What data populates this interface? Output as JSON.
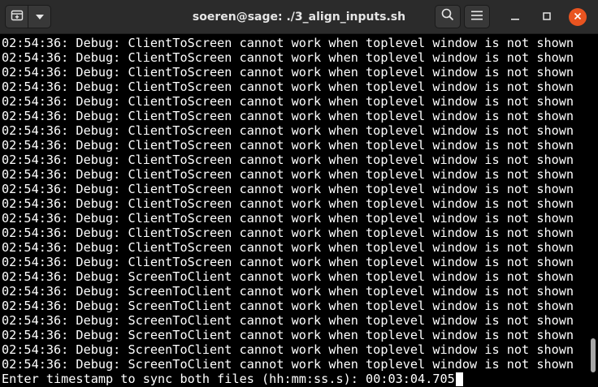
{
  "window": {
    "title": "soeren@sage: ./3_align_inputs.sh"
  },
  "toolbar": {
    "icons": {
      "new_tab": "new-tab-icon",
      "menu_dropdown": "chevron-down-icon",
      "search": "search-icon",
      "menu": "hamburger-icon",
      "minimize": "minimize-icon",
      "maximize": "maximize-icon",
      "close": "close-icon"
    }
  },
  "terminal": {
    "lines": [
      "02:54:36: Debug: ClientToScreen cannot work when toplevel window is not shown",
      "02:54:36: Debug: ClientToScreen cannot work when toplevel window is not shown",
      "02:54:36: Debug: ClientToScreen cannot work when toplevel window is not shown",
      "02:54:36: Debug: ClientToScreen cannot work when toplevel window is not shown",
      "02:54:36: Debug: ClientToScreen cannot work when toplevel window is not shown",
      "02:54:36: Debug: ClientToScreen cannot work when toplevel window is not shown",
      "02:54:36: Debug: ClientToScreen cannot work when toplevel window is not shown",
      "02:54:36: Debug: ClientToScreen cannot work when toplevel window is not shown",
      "02:54:36: Debug: ClientToScreen cannot work when toplevel window is not shown",
      "02:54:36: Debug: ClientToScreen cannot work when toplevel window is not shown",
      "02:54:36: Debug: ClientToScreen cannot work when toplevel window is not shown",
      "02:54:36: Debug: ClientToScreen cannot work when toplevel window is not shown",
      "02:54:36: Debug: ClientToScreen cannot work when toplevel window is not shown",
      "02:54:36: Debug: ClientToScreen cannot work when toplevel window is not shown",
      "02:54:36: Debug: ClientToScreen cannot work when toplevel window is not shown",
      "02:54:36: Debug: ClientToScreen cannot work when toplevel window is not shown",
      "02:54:36: Debug: ScreenToClient cannot work when toplevel window is not shown",
      "02:54:36: Debug: ScreenToClient cannot work when toplevel window is not shown",
      "02:54:36: Debug: ScreenToClient cannot work when toplevel window is not shown",
      "02:54:36: Debug: ScreenToClient cannot work when toplevel window is not shown",
      "02:54:36: Debug: ScreenToClient cannot work when toplevel window is not shown",
      "02:54:36: Debug: ScreenToClient cannot work when toplevel window is not shown",
      "02:54:36: Debug: ScreenToClient cannot work when toplevel window is not shown"
    ],
    "prompt": "Enter timestamp to sync both files (hh:mm:ss.s): ",
    "input_value": "00:03:04.705"
  },
  "colors": {
    "background": "#000000",
    "text": "#ffffff",
    "titlebar": "#2b2b2b",
    "close_button": "#e95420"
  }
}
